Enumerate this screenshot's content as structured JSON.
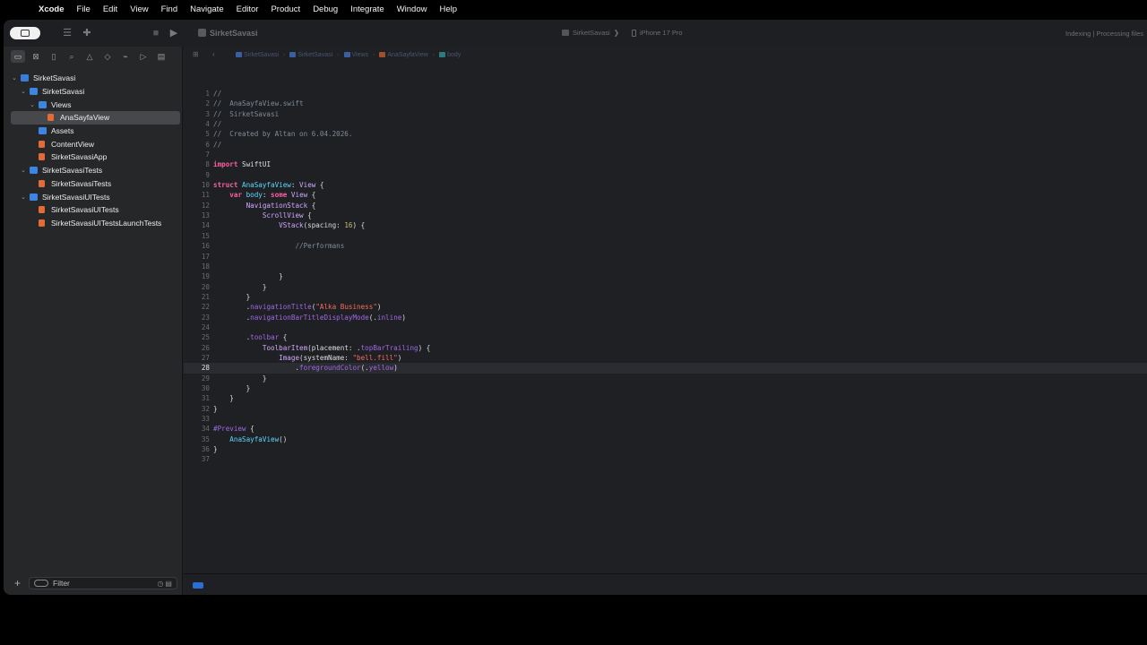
{
  "menubar": {
    "app": "Xcode",
    "items": [
      "File",
      "Edit",
      "View",
      "Find",
      "Navigate",
      "Editor",
      "Product",
      "Debug",
      "Integrate",
      "Window",
      "Help"
    ]
  },
  "toolbar": {
    "project_title": "SirketSavasi",
    "scheme": "SirketSavasi",
    "scheme_sep": "❯",
    "device": "iPhone 17 Pro",
    "status": "Indexing | Processing files"
  },
  "navigator": {
    "tree": [
      {
        "label": "SirketSavasi",
        "icon": "project-icon",
        "level": 0,
        "open": true
      },
      {
        "label": "SirketSavasi",
        "icon": "folder-icon",
        "level": 1,
        "open": true
      },
      {
        "label": "Views",
        "icon": "folder-icon",
        "level": 2,
        "open": true
      },
      {
        "label": "AnaSayfaView",
        "icon": "swift-file-icon",
        "level": 3,
        "selected": true
      },
      {
        "label": "Assets",
        "icon": "asset-catalog-icon",
        "level": 2
      },
      {
        "label": "ContentView",
        "icon": "swift-file-icon",
        "level": 2
      },
      {
        "label": "SirketSavasiApp",
        "icon": "swift-file-icon",
        "level": 2
      },
      {
        "label": "SirketSavasiTests",
        "icon": "folder-icon",
        "level": 1,
        "open": true
      },
      {
        "label": "SirketSavasiTests",
        "icon": "swift-file-icon",
        "level": 2
      },
      {
        "label": "SirketSavasiUITests",
        "icon": "folder-icon",
        "level": 1,
        "open": true
      },
      {
        "label": "SirketSavasiUITests",
        "icon": "swift-file-icon",
        "level": 2
      },
      {
        "label": "SirketSavasiUITestsLaunchTests",
        "icon": "swift-file-icon",
        "level": 2
      }
    ],
    "filter_placeholder": "Filter"
  },
  "jumpbar": {
    "crumbs": [
      "SirketSavasi",
      "SirketSavasi",
      "Views",
      "AnaSayfaView",
      "body"
    ]
  },
  "editor": {
    "current_line": 28,
    "lines": [
      [
        [
          "cm",
          "//"
        ]
      ],
      [
        [
          "cm",
          "//  AnaSayfaView.swift"
        ]
      ],
      [
        [
          "cm",
          "//  SirketSavasi"
        ]
      ],
      [
        [
          "cm",
          "//"
        ]
      ],
      [
        [
          "cm",
          "//  Created by Altan on 6.04.2026."
        ]
      ],
      [
        [
          "cm",
          "//"
        ]
      ],
      [],
      [
        [
          "kw",
          "import"
        ],
        [
          "pl",
          " SwiftUI"
        ]
      ],
      [],
      [
        [
          "kw",
          "struct"
        ],
        [
          "pl",
          " "
        ],
        [
          "ty",
          "AnaSayfaView"
        ],
        [
          "pl",
          ": "
        ],
        [
          "tyu",
          "View"
        ],
        [
          "pl",
          " {"
        ]
      ],
      [
        [
          "pl",
          "    "
        ],
        [
          "kw",
          "var"
        ],
        [
          "pl",
          " "
        ],
        [
          "ty",
          "body"
        ],
        [
          "pl",
          ": "
        ],
        [
          "kw",
          "some"
        ],
        [
          "pl",
          " "
        ],
        [
          "tyu",
          "View"
        ],
        [
          "pl",
          " {"
        ]
      ],
      [
        [
          "pl",
          "        "
        ],
        [
          "tyu",
          "NavigationStack"
        ],
        [
          "pl",
          " {"
        ]
      ],
      [
        [
          "pl",
          "            "
        ],
        [
          "tyu",
          "ScrollView"
        ],
        [
          "pl",
          " {"
        ]
      ],
      [
        [
          "pl",
          "                "
        ],
        [
          "tyu",
          "VStack"
        ],
        [
          "pl",
          "(spacing: "
        ],
        [
          "nm",
          "16"
        ],
        [
          "pl",
          ") {"
        ]
      ],
      [],
      [
        [
          "pl",
          "                    "
        ],
        [
          "cm",
          "//Performans"
        ]
      ],
      [],
      [],
      [
        [
          "pl",
          "                }"
        ]
      ],
      [
        [
          "pl",
          "            }"
        ]
      ],
      [
        [
          "pl",
          "        }"
        ]
      ],
      [
        [
          "pl",
          "        ."
        ],
        [
          "mc",
          "navigationTitle"
        ],
        [
          "pl",
          "("
        ],
        [
          "st",
          "\"Alka Business\""
        ],
        [
          "pl",
          ")"
        ]
      ],
      [
        [
          "pl",
          "        ."
        ],
        [
          "mc",
          "navigationBarTitleDisplayMode"
        ],
        [
          "pl",
          "(."
        ],
        [
          "mc",
          "inline"
        ],
        [
          "pl",
          ")"
        ]
      ],
      [],
      [
        [
          "pl",
          "        ."
        ],
        [
          "mc",
          "toolbar"
        ],
        [
          "pl",
          " {"
        ]
      ],
      [
        [
          "pl",
          "            "
        ],
        [
          "tyu",
          "ToolbarItem"
        ],
        [
          "pl",
          "(placement: ."
        ],
        [
          "mc",
          "topBarTrailing"
        ],
        [
          "pl",
          ") {"
        ]
      ],
      [
        [
          "pl",
          "                "
        ],
        [
          "tyu",
          "Image"
        ],
        [
          "pl",
          "(systemName: "
        ],
        [
          "st",
          "\"bell.fill\""
        ],
        [
          "pl",
          ")"
        ]
      ],
      [
        [
          "pl",
          "                    ."
        ],
        [
          "mc",
          "foregroundColor"
        ],
        [
          "pl",
          "(."
        ],
        [
          "mc",
          "yellow"
        ],
        [
          "pl",
          ")"
        ]
      ],
      [
        [
          "pl",
          "            }"
        ]
      ],
      [
        [
          "pl",
          "        }"
        ]
      ],
      [
        [
          "pl",
          "    }"
        ]
      ],
      [
        [
          "pl",
          "}"
        ]
      ],
      [],
      [
        [
          "tyd",
          "#Preview"
        ],
        [
          "pl",
          " {"
        ]
      ],
      [
        [
          "pl",
          "    "
        ],
        [
          "ty",
          "AnaSayfaView"
        ],
        [
          "pl",
          "()"
        ]
      ],
      [
        [
          "pl",
          "}"
        ]
      ],
      []
    ]
  },
  "colors": {
    "keyword": "#fc5fa3",
    "type": "#d0a8ff",
    "string": "#fc6a5d",
    "number": "#d0bf69",
    "comment": "#7f8c98",
    "accent": "#2b6fd6"
  }
}
